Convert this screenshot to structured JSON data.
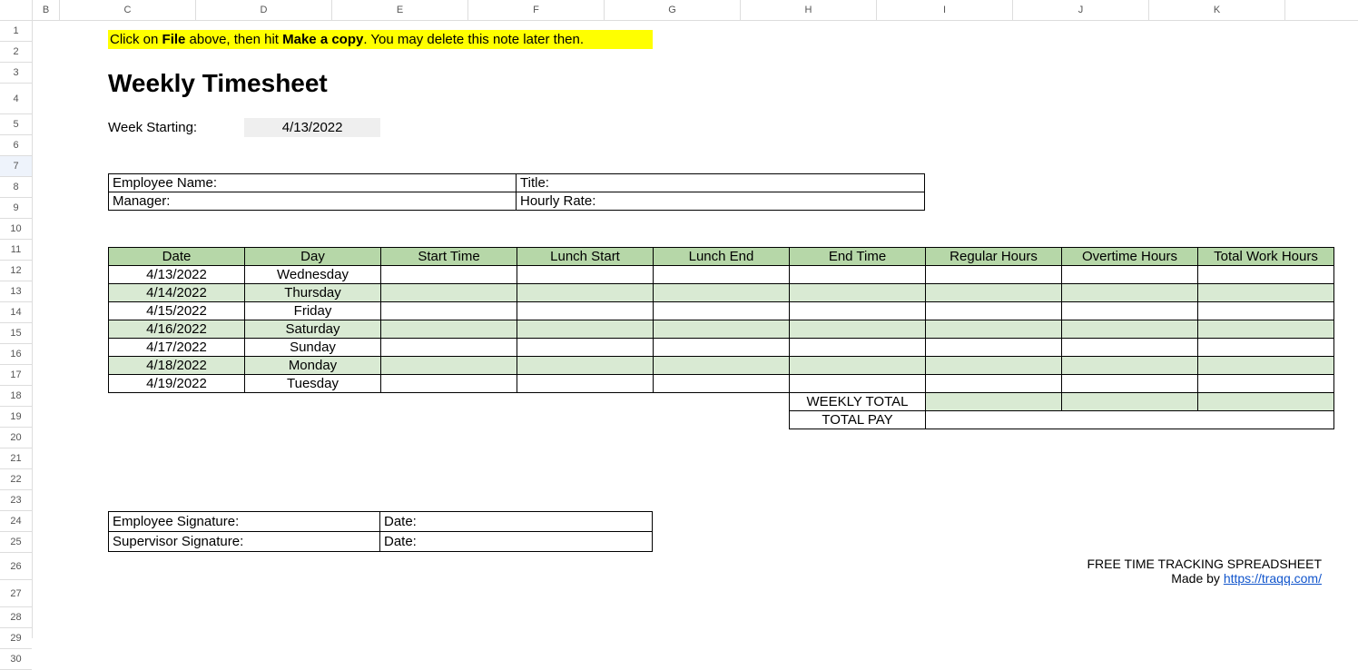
{
  "note": {
    "pre": "Click on ",
    "bold1": "File",
    "mid": " above, then hit ",
    "bold2": "Make a copy",
    "post": ". You may delete this note later then."
  },
  "title": "Weekly Timesheet",
  "week_starting_label": "Week Starting:",
  "week_starting_value": "4/13/2022",
  "info": {
    "employee_name_label": "Employee Name:",
    "title_label": "Title:",
    "manager_label": "Manager:",
    "hourly_rate_label": "Hourly Rate:"
  },
  "columns": [
    "B",
    "C",
    "D",
    "E",
    "F",
    "G",
    "H",
    "I",
    "J",
    "K"
  ],
  "table": {
    "headers": [
      "Date",
      "Day",
      "Start Time",
      "Lunch Start",
      "Lunch End",
      "End Time",
      "Regular Hours",
      "Overtime Hours",
      "Total Work Hours"
    ],
    "rows": [
      {
        "date": "4/13/2022",
        "day": "Wednesday"
      },
      {
        "date": "4/14/2022",
        "day": "Thursday"
      },
      {
        "date": "4/15/2022",
        "day": "Friday"
      },
      {
        "date": "4/16/2022",
        "day": "Saturday"
      },
      {
        "date": "4/17/2022",
        "day": "Sunday"
      },
      {
        "date": "4/18/2022",
        "day": "Monday"
      },
      {
        "date": "4/19/2022",
        "day": "Tuesday"
      }
    ],
    "weekly_total_label": "WEEKLY TOTAL",
    "total_pay_label": "TOTAL PAY"
  },
  "signatures": {
    "employee_sig": "Employee Signature:",
    "supervisor_sig": "Supervisor Signature:",
    "date_label": "Date:"
  },
  "footer": {
    "line1": "FREE TIME TRACKING SPREADSHEET",
    "made_by": "Made by ",
    "link": "https://traqq.com/"
  }
}
